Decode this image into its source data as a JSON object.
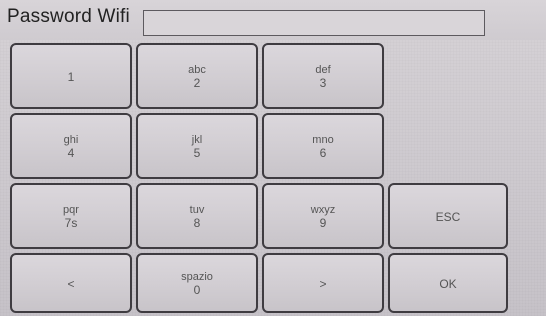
{
  "header": {
    "title": "Password Wifi",
    "input_value": ""
  },
  "keys": {
    "k1": {
      "top": "",
      "bottom": "1"
    },
    "k2": {
      "top": "abc",
      "bottom": "2"
    },
    "k3": {
      "top": "def",
      "bottom": "3"
    },
    "k4": {
      "top": "ghi",
      "bottom": "4"
    },
    "k5": {
      "top": "jkl",
      "bottom": "5"
    },
    "k6": {
      "top": "mno",
      "bottom": "6"
    },
    "k7": {
      "top": "pqr",
      "bottom": "7s"
    },
    "k8": {
      "top": "tuv",
      "bottom": "8"
    },
    "k9": {
      "top": "wxyz",
      "bottom": "9"
    },
    "esc": {
      "top": "",
      "bottom": "ESC"
    },
    "left": {
      "top": "",
      "bottom": "<"
    },
    "space": {
      "top": "spazio",
      "bottom": "0"
    },
    "right": {
      "top": "",
      "bottom": ">"
    },
    "ok": {
      "top": "",
      "bottom": "OK"
    }
  }
}
